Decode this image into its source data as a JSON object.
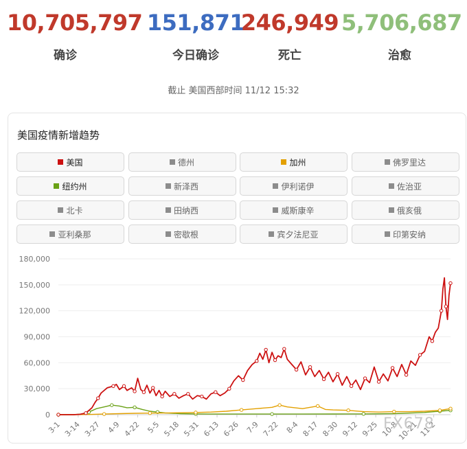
{
  "stats": [
    {
      "value": "10,705,797",
      "label": "确诊",
      "color": "#c0392b"
    },
    {
      "value": "151,871",
      "label": "今日确诊",
      "color": "#3d6cc0"
    },
    {
      "value": "246,949",
      "label": "死亡",
      "color": "#c0392b"
    },
    {
      "value": "5,706,687",
      "label": "治愈",
      "color": "#8fbf7a"
    }
  ],
  "as_of": "截止 美国西部时间 11/12 15:32",
  "panel_title": "美国疫情新增趋势",
  "legend": [
    {
      "label": "美国",
      "color": "#cc1010",
      "active": true
    },
    {
      "label": "德州",
      "color": "#8c8c8c",
      "active": false
    },
    {
      "label": "加州",
      "color": "#e3a000",
      "active": true
    },
    {
      "label": "佛罗里达",
      "color": "#8c8c8c",
      "active": false
    },
    {
      "label": "纽约州",
      "color": "#6aa116",
      "active": true
    },
    {
      "label": "新泽西",
      "color": "#8c8c8c",
      "active": false
    },
    {
      "label": "伊利诺伊",
      "color": "#8c8c8c",
      "active": false
    },
    {
      "label": "佐治亚",
      "color": "#8c8c8c",
      "active": false
    },
    {
      "label": "北卡",
      "color": "#8c8c8c",
      "active": false
    },
    {
      "label": "田纳西",
      "color": "#8c8c8c",
      "active": false
    },
    {
      "label": "威斯康辛",
      "color": "#8c8c8c",
      "active": false
    },
    {
      "label": "俄亥俄",
      "color": "#8c8c8c",
      "active": false
    },
    {
      "label": "亚利桑那",
      "color": "#8c8c8c",
      "active": false
    },
    {
      "label": "密歇根",
      "color": "#8c8c8c",
      "active": false
    },
    {
      "label": "宾夕法尼亚",
      "color": "#8c8c8c",
      "active": false
    },
    {
      "label": "印第安纳",
      "color": "#8c8c8c",
      "active": false
    }
  ],
  "chart_data": {
    "type": "line",
    "y_ticks": [
      "0",
      "30,000",
      "60,000",
      "90,000",
      "120,000",
      "150,000",
      "180,000"
    ],
    "ylim": [
      0,
      180000
    ],
    "x_ticks": [
      "3-1",
      "3-14",
      "3-27",
      "4-9",
      "4-22",
      "5-5",
      "5-18",
      "5-31",
      "6-13",
      "6-26",
      "7-9",
      "7-22",
      "8-4",
      "8-17",
      "8-30",
      "9-12",
      "9-25",
      "10-8",
      "10-21",
      "11-2"
    ],
    "x_day_index": [
      0,
      13,
      26,
      39,
      52,
      65,
      78,
      91,
      104,
      117,
      130,
      143,
      156,
      169,
      182,
      195,
      208,
      221,
      234,
      246
    ],
    "x_range_days": [
      0,
      257
    ],
    "series": [
      {
        "name": "美国",
        "color": "#cc1010",
        "day": [
          0,
          10,
          14,
          18,
          22,
          24,
          26,
          28,
          32,
          36,
          38,
          40,
          43,
          45,
          48,
          50,
          52,
          54,
          56,
          58,
          60,
          62,
          64,
          66,
          68,
          70,
          73,
          76,
          79,
          82,
          85,
          88,
          91,
          94,
          97,
          100,
          103,
          106,
          109,
          112,
          115,
          118,
          121,
          124,
          127,
          130,
          132,
          134,
          136,
          138,
          140,
          142,
          144,
          146,
          148,
          150,
          153,
          156,
          159,
          162,
          165,
          168,
          171,
          174,
          177,
          180,
          183,
          186,
          189,
          192,
          195,
          198,
          201,
          204,
          207,
          210,
          213,
          216,
          219,
          222,
          225,
          228,
          231,
          234,
          237,
          240,
          243,
          245,
          247,
          249,
          251,
          252,
          253,
          254,
          255,
          256,
          257
        ],
        "values": [
          0,
          0,
          400,
          1800,
          8000,
          14000,
          19000,
          25000,
          31000,
          33000,
          35000,
          29000,
          33000,
          28000,
          31000,
          27000,
          42000,
          29000,
          26000,
          34000,
          25000,
          31000,
          22000,
          28000,
          21000,
          27000,
          21000,
          24000,
          19000,
          22000,
          24000,
          18000,
          22000,
          21000,
          18000,
          24000,
          26000,
          22000,
          25000,
          30000,
          39000,
          45000,
          40000,
          51000,
          58000,
          62000,
          71000,
          64000,
          75000,
          60000,
          72000,
          63000,
          68000,
          66000,
          76000,
          64000,
          58000,
          52000,
          61000,
          46000,
          55000,
          44000,
          51000,
          41000,
          49000,
          38000,
          47000,
          34000,
          44000,
          33000,
          40000,
          29000,
          42000,
          37000,
          55000,
          38000,
          47000,
          39000,
          54000,
          44000,
          58000,
          46000,
          62000,
          57000,
          69000,
          73000,
          90000,
          85000,
          95000,
          100000,
          120000,
          145000,
          158000,
          125000,
          110000,
          138000,
          151871
        ]
      },
      {
        "name": "加州",
        "color": "#e3a000",
        "day": [
          0,
          10,
          20,
          30,
          40,
          50,
          60,
          70,
          80,
          90,
          100,
          110,
          120,
          130,
          140,
          145,
          150,
          160,
          170,
          175,
          180,
          190,
          200,
          210,
          220,
          230,
          240,
          250,
          257
        ],
        "values": [
          0,
          0,
          200,
          700,
          1200,
          1600,
          1800,
          1900,
          2200,
          2500,
          3000,
          4000,
          5500,
          7000,
          8500,
          11000,
          9000,
          7000,
          10000,
          6000,
          5500,
          5000,
          3500,
          3000,
          3500,
          3500,
          4000,
          5000,
          7000
        ]
      },
      {
        "name": "纽约州",
        "color": "#6aa116",
        "day": [
          0,
          10,
          15,
          20,
          25,
          30,
          35,
          40,
          45,
          50,
          55,
          60,
          65,
          70,
          80,
          90,
          100,
          120,
          140,
          160,
          180,
          200,
          220,
          240,
          250,
          257
        ],
        "values": [
          0,
          0,
          700,
          3000,
          7000,
          9000,
          11000,
          10000,
          8000,
          8500,
          6000,
          4000,
          3000,
          2000,
          1200,
          900,
          700,
          700,
          700,
          700,
          800,
          900,
          1200,
          2500,
          4000,
          5000
        ]
      }
    ]
  },
  "watermark": "FX678"
}
